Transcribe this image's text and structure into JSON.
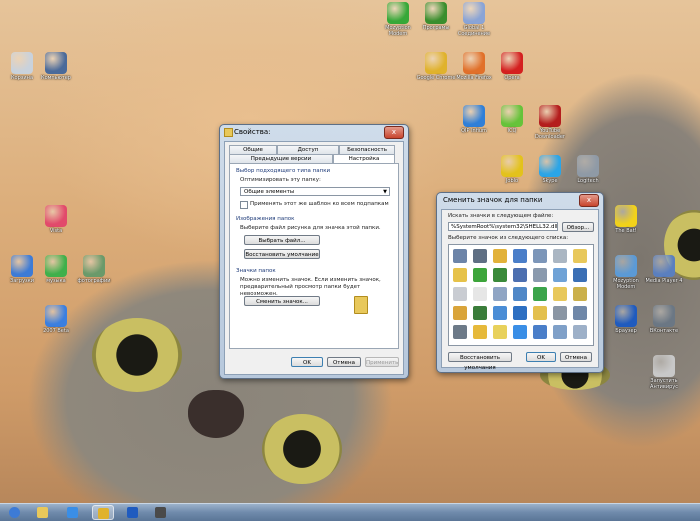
{
  "colors": {
    "accent": "#3a8ee6",
    "titlebar": "#b7c8dc",
    "taskbar": "#6f8aab"
  },
  "desktop_icons": [
    {
      "label": "Корзина",
      "icon": "recycle-bin-icon",
      "color": "#c9d2dc"
    },
    {
      "label": "Компьютер",
      "icon": "computer-icon",
      "color": "#4a6a9a"
    },
    {
      "label": "Vista",
      "icon": "msn-butterfly-icon",
      "color": "#e24a6b"
    },
    {
      "label": "Загрузки",
      "icon": "downloads-icon",
      "color": "#3d7bd6"
    },
    {
      "label": "музыка",
      "icon": "media-player-icon",
      "color": "#3fb04b"
    },
    {
      "label": "фотографии",
      "icon": "users-icon",
      "color": "#6a9a6a"
    },
    {
      "label": "2007 Beta",
      "icon": "info-icon",
      "color": "#3b7fe0"
    },
    {
      "label": "Mozyption Modem",
      "icon": "network-globe-icon",
      "color": "#36a838"
    },
    {
      "label": "Програмы",
      "icon": "tree-icon",
      "color": "#3a8e2e"
    },
    {
      "label": "Global 1 Соединение",
      "icon": "globe-icon",
      "color": "#8aa4d6"
    },
    {
      "label": "Google Chrome",
      "icon": "chrome-icon",
      "color": "#e0b22c"
    },
    {
      "label": "Mozilla Firefox",
      "icon": "firefox-icon",
      "color": "#e1702a"
    },
    {
      "label": "Opera",
      "icon": "opera-icon",
      "color": "#d42020"
    },
    {
      "label": "QIP Infium",
      "icon": "qip-icon",
      "color": "#2f7fd8"
    },
    {
      "label": "ICQ",
      "icon": "icq-flower-icon",
      "color": "#66c33a"
    },
    {
      "label": "YouTube Downloader",
      "icon": "tv-icon",
      "color": "#b41d1d"
    },
    {
      "label": "Joblo",
      "icon": "joblo-icon",
      "color": "#e3c21c"
    },
    {
      "label": "Skype",
      "icon": "skype-icon",
      "color": "#2ba5e7"
    },
    {
      "label": "Logitech",
      "icon": "logitech-icon",
      "color": "#8f9aa6"
    },
    {
      "label": "The Bat!",
      "icon": "bat-icon",
      "color": "#f2d21a"
    },
    {
      "label": "Mozyption Modem",
      "icon": "photo-icon",
      "color": "#5b9ad6"
    },
    {
      "label": "Media Player 4",
      "icon": "media-icon",
      "color": "#5a7fbf"
    },
    {
      "label": "Браузер",
      "icon": "phone-icon",
      "color": "#1f5bbf"
    },
    {
      "label": "ВКонтакте",
      "icon": "network-icon",
      "color": "#6b7784"
    },
    {
      "label": "Запустить Антивирус",
      "icon": "antivirus-icon",
      "color": "#c8c8c8"
    }
  ],
  "props_window": {
    "title": "Свойства:",
    "close_label": "x",
    "tabs_row1": [
      "Общие",
      "Доступ",
      "Безопасность"
    ],
    "tabs_row2": [
      "Предыдущие версии",
      "Настройка"
    ],
    "group1_title": "Выбор подходящего типа папки",
    "optimize_label": "Оптимизировать эту папку:",
    "optimize_value": "Общие элементы",
    "apply_subfolders_label": "Применять этот же шаблон ко всем подпапкам",
    "group2_title": "Изображения папок",
    "choose_file_desc": "Выберите файл рисунка для значка этой папки.",
    "choose_file_btn": "Выбрать файл...",
    "restore_default_btn": "Восстановить умолчание",
    "group3_title": "Значки папок",
    "icons_desc": "Можно изменить значок. Если изменить значок, предварительный просмотр папки будет невозможен.",
    "change_icon_btn": "Сменить значок...",
    "ok": "OK",
    "cancel": "Отмена",
    "apply": "Применить"
  },
  "change_icon_window": {
    "title": "Сменить значок для папки",
    "close_label": "x",
    "search_label": "Искать значки в следующем файле:",
    "file_path": "%SystemRoot%\\system32\\SHELL32.dll",
    "browse_btn": "Обзор...",
    "select_label": "Выберите значок из следующего списка:",
    "restore_btn": "Восстановить умолчания",
    "ok": "OK",
    "cancel": "Отмена",
    "icon_colors": [
      "#6c84a8",
      "#5f6f84",
      "#e2b23a",
      "#4a7ec9",
      "#7c96b9",
      "#aab6c3",
      "#e8c85b",
      "#e6c24a",
      "#3da53b",
      "#3a8a3a",
      "#4c6fb0",
      "#8a9aae",
      "#6fa2d6",
      "#3b6fb5",
      "#c9ccd2",
      "#e6e6e6",
      "#8fa5c4",
      "#4f87c7",
      "#3ba44b",
      "#e8c85b",
      "#cbb04a",
      "#d9a43a",
      "#3a7d3a",
      "#4a8dd6",
      "#2d6fc2",
      "#e3c04d",
      "#8a96a4",
      "#6f87a8",
      "#6d7a88",
      "#e6b93a",
      "#e8d15b",
      "#3a8ee6",
      "#4a7ec9",
      "#7fa0c8",
      "#9db0c8"
    ]
  },
  "taskbar": {
    "items": [
      {
        "icon": "start-orb-icon",
        "color": "#3d7bd6"
      },
      {
        "icon": "folder-icon",
        "color": "#e8c85b"
      },
      {
        "icon": "ie-icon",
        "color": "#3a8ee6"
      },
      {
        "icon": "chrome-icon",
        "color": "#e0b22c"
      },
      {
        "icon": "phone-icon",
        "color": "#1f5bbf"
      },
      {
        "icon": "film-icon",
        "color": "#4a4a4a"
      }
    ]
  }
}
